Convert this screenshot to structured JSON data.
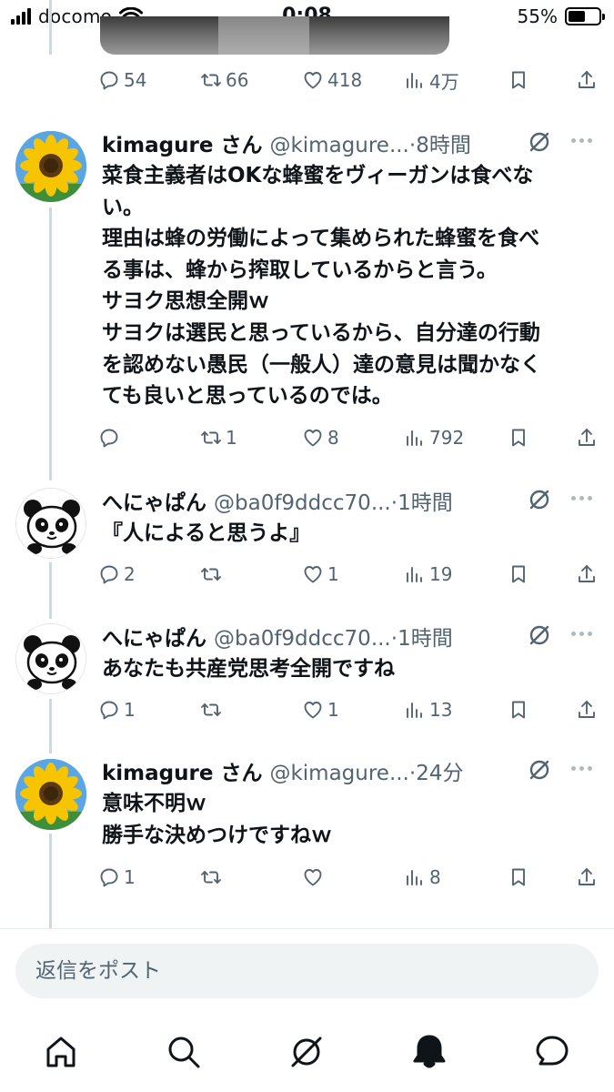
{
  "status_bar": {
    "carrier": "docomo",
    "time": "0:08",
    "battery": "55%",
    "battery_level": 0.55
  },
  "top_post_actions": {
    "replies": "54",
    "reposts": "66",
    "likes": "418",
    "views": "4万"
  },
  "tweets": [
    {
      "name": "kimagure さん",
      "handle": "@kimagure...",
      "dot": "·",
      "time": "8時間",
      "avatar": "sunflower",
      "lines": [
        "菜食主義者はOKな蜂蜜をヴィーガンは食べな",
        "い。",
        "理由は蜂の労働によって集められた蜂蜜を食べ",
        "る事は、蜂から搾取しているからと言う。",
        "サヨク思想全開ｗ",
        "サヨクは選民と思っているから、自分達の行動",
        "を認めない愚民（一般人）達の意見は聞かなく",
        "ても良いと思っているのでは。"
      ],
      "replies": "",
      "reposts": "1",
      "likes": "8",
      "views": "792"
    },
    {
      "name": "へにゃぱん",
      "handle": "@ba0f9ddcc70...",
      "dot": "·",
      "time": "1時間",
      "avatar": "panda",
      "lines": [
        "『人によると思うよ』"
      ],
      "replies": "2",
      "reposts": "",
      "likes": "1",
      "views": "19"
    },
    {
      "name": "へにゃぱん",
      "handle": "@ba0f9ddcc70...",
      "dot": "·",
      "time": "1時間",
      "avatar": "panda",
      "lines": [
        "あなたも共産党思考全開ですね"
      ],
      "replies": "1",
      "reposts": "",
      "likes": "1",
      "views": "13"
    },
    {
      "name": "kimagure さん",
      "handle": "@kimagure...",
      "dot": "·",
      "time": "24分",
      "avatar": "sunflower",
      "lines": [
        "意味不明ｗ",
        "勝手な決めつけですねｗ"
      ],
      "replies": "1",
      "reposts": "",
      "likes": "",
      "views": "8"
    }
  ],
  "reply_box": {
    "placeholder": "返信をポスト"
  },
  "tab_bar": {
    "icons": [
      "home-icon",
      "search-icon",
      "grok-icon",
      "notifications-icon",
      "messages-icon"
    ]
  },
  "colors": {
    "text": "#0f1419",
    "secondary": "#536471",
    "thread_line": "#cfd9de",
    "reply_box_bg": "#eff3f4"
  }
}
